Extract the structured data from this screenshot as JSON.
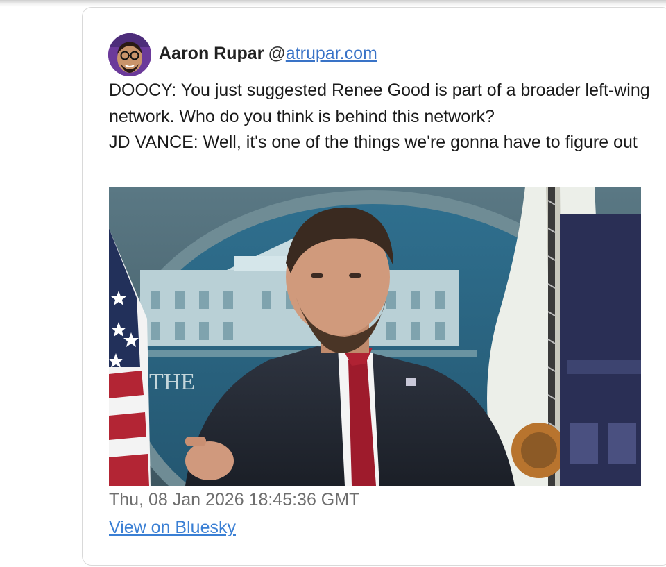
{
  "post": {
    "author_name": "Aaron Rupar",
    "handle_prefix": "@",
    "handle": "atrupar.com",
    "text_lines": [
      "DOOCY: You just suggested Renee Good is part of a broader left-wing network. Who do you think is behind this network?",
      "JD VANCE: Well, it's one of the things we're gonna have to figure out"
    ],
    "media_caption_text": "THE",
    "timestamp": "Thu, 08 Jan 2026 18:45:36 GMT",
    "view_link_label": "View on Bluesky"
  },
  "colors": {
    "link": "#3a7fd4",
    "timestamp": "#6e6e6e",
    "card_border": "#d9d9d9"
  },
  "icons": {
    "avatar": "person-avatar"
  }
}
